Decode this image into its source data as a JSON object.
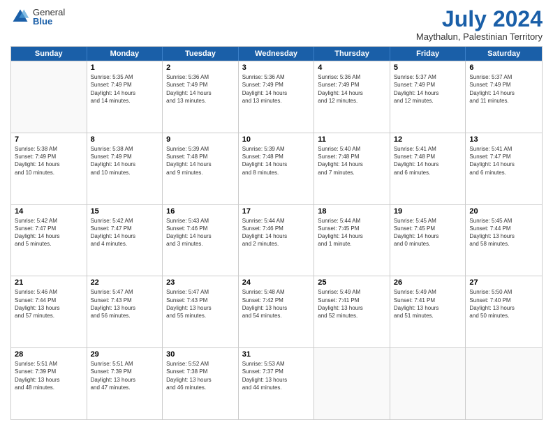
{
  "logo": {
    "general": "General",
    "blue": "Blue"
  },
  "title": "July 2024",
  "subtitle": "Maythalun, Palestinian Territory",
  "headers": [
    "Sunday",
    "Monday",
    "Tuesday",
    "Wednesday",
    "Thursday",
    "Friday",
    "Saturday"
  ],
  "weeks": [
    [
      {
        "day": "",
        "lines": []
      },
      {
        "day": "1",
        "lines": [
          "Sunrise: 5:35 AM",
          "Sunset: 7:49 PM",
          "Daylight: 14 hours",
          "and 14 minutes."
        ]
      },
      {
        "day": "2",
        "lines": [
          "Sunrise: 5:36 AM",
          "Sunset: 7:49 PM",
          "Daylight: 14 hours",
          "and 13 minutes."
        ]
      },
      {
        "day": "3",
        "lines": [
          "Sunrise: 5:36 AM",
          "Sunset: 7:49 PM",
          "Daylight: 14 hours",
          "and 13 minutes."
        ]
      },
      {
        "day": "4",
        "lines": [
          "Sunrise: 5:36 AM",
          "Sunset: 7:49 PM",
          "Daylight: 14 hours",
          "and 12 minutes."
        ]
      },
      {
        "day": "5",
        "lines": [
          "Sunrise: 5:37 AM",
          "Sunset: 7:49 PM",
          "Daylight: 14 hours",
          "and 12 minutes."
        ]
      },
      {
        "day": "6",
        "lines": [
          "Sunrise: 5:37 AM",
          "Sunset: 7:49 PM",
          "Daylight: 14 hours",
          "and 11 minutes."
        ]
      }
    ],
    [
      {
        "day": "7",
        "lines": [
          "Sunrise: 5:38 AM",
          "Sunset: 7:49 PM",
          "Daylight: 14 hours",
          "and 10 minutes."
        ]
      },
      {
        "day": "8",
        "lines": [
          "Sunrise: 5:38 AM",
          "Sunset: 7:49 PM",
          "Daylight: 14 hours",
          "and 10 minutes."
        ]
      },
      {
        "day": "9",
        "lines": [
          "Sunrise: 5:39 AM",
          "Sunset: 7:48 PM",
          "Daylight: 14 hours",
          "and 9 minutes."
        ]
      },
      {
        "day": "10",
        "lines": [
          "Sunrise: 5:39 AM",
          "Sunset: 7:48 PM",
          "Daylight: 14 hours",
          "and 8 minutes."
        ]
      },
      {
        "day": "11",
        "lines": [
          "Sunrise: 5:40 AM",
          "Sunset: 7:48 PM",
          "Daylight: 14 hours",
          "and 7 minutes."
        ]
      },
      {
        "day": "12",
        "lines": [
          "Sunrise: 5:41 AM",
          "Sunset: 7:48 PM",
          "Daylight: 14 hours",
          "and 6 minutes."
        ]
      },
      {
        "day": "13",
        "lines": [
          "Sunrise: 5:41 AM",
          "Sunset: 7:47 PM",
          "Daylight: 14 hours",
          "and 6 minutes."
        ]
      }
    ],
    [
      {
        "day": "14",
        "lines": [
          "Sunrise: 5:42 AM",
          "Sunset: 7:47 PM",
          "Daylight: 14 hours",
          "and 5 minutes."
        ]
      },
      {
        "day": "15",
        "lines": [
          "Sunrise: 5:42 AM",
          "Sunset: 7:47 PM",
          "Daylight: 14 hours",
          "and 4 minutes."
        ]
      },
      {
        "day": "16",
        "lines": [
          "Sunrise: 5:43 AM",
          "Sunset: 7:46 PM",
          "Daylight: 14 hours",
          "and 3 minutes."
        ]
      },
      {
        "day": "17",
        "lines": [
          "Sunrise: 5:44 AM",
          "Sunset: 7:46 PM",
          "Daylight: 14 hours",
          "and 2 minutes."
        ]
      },
      {
        "day": "18",
        "lines": [
          "Sunrise: 5:44 AM",
          "Sunset: 7:45 PM",
          "Daylight: 14 hours",
          "and 1 minute."
        ]
      },
      {
        "day": "19",
        "lines": [
          "Sunrise: 5:45 AM",
          "Sunset: 7:45 PM",
          "Daylight: 14 hours",
          "and 0 minutes."
        ]
      },
      {
        "day": "20",
        "lines": [
          "Sunrise: 5:45 AM",
          "Sunset: 7:44 PM",
          "Daylight: 13 hours",
          "and 58 minutes."
        ]
      }
    ],
    [
      {
        "day": "21",
        "lines": [
          "Sunrise: 5:46 AM",
          "Sunset: 7:44 PM",
          "Daylight: 13 hours",
          "and 57 minutes."
        ]
      },
      {
        "day": "22",
        "lines": [
          "Sunrise: 5:47 AM",
          "Sunset: 7:43 PM",
          "Daylight: 13 hours",
          "and 56 minutes."
        ]
      },
      {
        "day": "23",
        "lines": [
          "Sunrise: 5:47 AM",
          "Sunset: 7:43 PM",
          "Daylight: 13 hours",
          "and 55 minutes."
        ]
      },
      {
        "day": "24",
        "lines": [
          "Sunrise: 5:48 AM",
          "Sunset: 7:42 PM",
          "Daylight: 13 hours",
          "and 54 minutes."
        ]
      },
      {
        "day": "25",
        "lines": [
          "Sunrise: 5:49 AM",
          "Sunset: 7:41 PM",
          "Daylight: 13 hours",
          "and 52 minutes."
        ]
      },
      {
        "day": "26",
        "lines": [
          "Sunrise: 5:49 AM",
          "Sunset: 7:41 PM",
          "Daylight: 13 hours",
          "and 51 minutes."
        ]
      },
      {
        "day": "27",
        "lines": [
          "Sunrise: 5:50 AM",
          "Sunset: 7:40 PM",
          "Daylight: 13 hours",
          "and 50 minutes."
        ]
      }
    ],
    [
      {
        "day": "28",
        "lines": [
          "Sunrise: 5:51 AM",
          "Sunset: 7:39 PM",
          "Daylight: 13 hours",
          "and 48 minutes."
        ]
      },
      {
        "day": "29",
        "lines": [
          "Sunrise: 5:51 AM",
          "Sunset: 7:39 PM",
          "Daylight: 13 hours",
          "and 47 minutes."
        ]
      },
      {
        "day": "30",
        "lines": [
          "Sunrise: 5:52 AM",
          "Sunset: 7:38 PM",
          "Daylight: 13 hours",
          "and 46 minutes."
        ]
      },
      {
        "day": "31",
        "lines": [
          "Sunrise: 5:53 AM",
          "Sunset: 7:37 PM",
          "Daylight: 13 hours",
          "and 44 minutes."
        ]
      },
      {
        "day": "",
        "lines": []
      },
      {
        "day": "",
        "lines": []
      },
      {
        "day": "",
        "lines": []
      }
    ]
  ]
}
